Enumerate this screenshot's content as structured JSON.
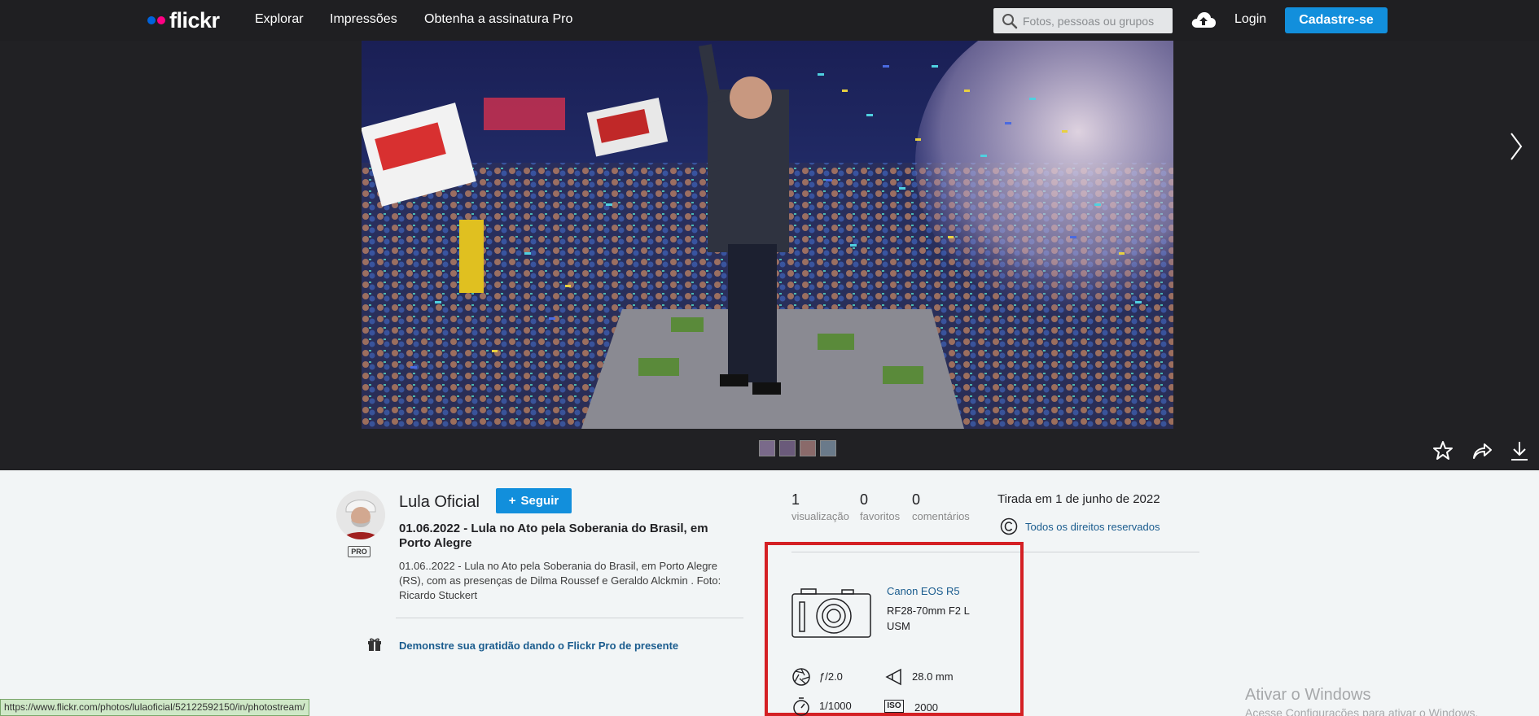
{
  "header": {
    "logo_text": "flickr",
    "nav": [
      "Explorar",
      "Impressões",
      "Obtenha a assinatura Pro"
    ],
    "search_placeholder": "Fotos, pessoas ou grupos",
    "login": "Login",
    "signup": "Cadastre-se"
  },
  "photo": {
    "owner": "Lula Oficial",
    "follow_label": "Seguir",
    "pro_badge": "PRO",
    "title": "01.06.2022 - Lula no Ato pela Soberania do Brasil, em Porto Alegre",
    "description": "01.06..2022 - Lula no Ato pela Soberania do Brasil, em Porto Alegre (RS), com as presenças de Dilma Roussef e Geraldo Alckmin . Foto: Ricardo Stuckert",
    "gift_link": "Demonstre sua gratidão dando o Flickr Pro de presente"
  },
  "stats": [
    {
      "value": "1",
      "label": "visualização"
    },
    {
      "value": "0",
      "label": "favoritos"
    },
    {
      "value": "0",
      "label": "comentários"
    }
  ],
  "meta": {
    "taken": "Tirada em 1 de junho de 2022",
    "rights": "Todos os direitos reservados"
  },
  "exif": {
    "camera": "Canon EOS R5",
    "lens": "RF28-70mm F2 L USM",
    "aperture": "ƒ/2.0",
    "focal_length": "28.0 mm",
    "shutter": "1/1000",
    "iso_label": "ISO",
    "iso": "2000"
  },
  "status_url": "https://www.flickr.com/photos/lulaoficial/52122592150/in/photostream/",
  "watermark": {
    "title": "Ativar o Windows",
    "subtitle": "Acesse Configurações para ativar o Windows."
  },
  "colors": {
    "brand_blue": "#0063dc",
    "brand_pink": "#ff0084",
    "button_blue": "#128fdc",
    "highlight_red": "#d42024",
    "link_blue": "#1a5c8e"
  }
}
